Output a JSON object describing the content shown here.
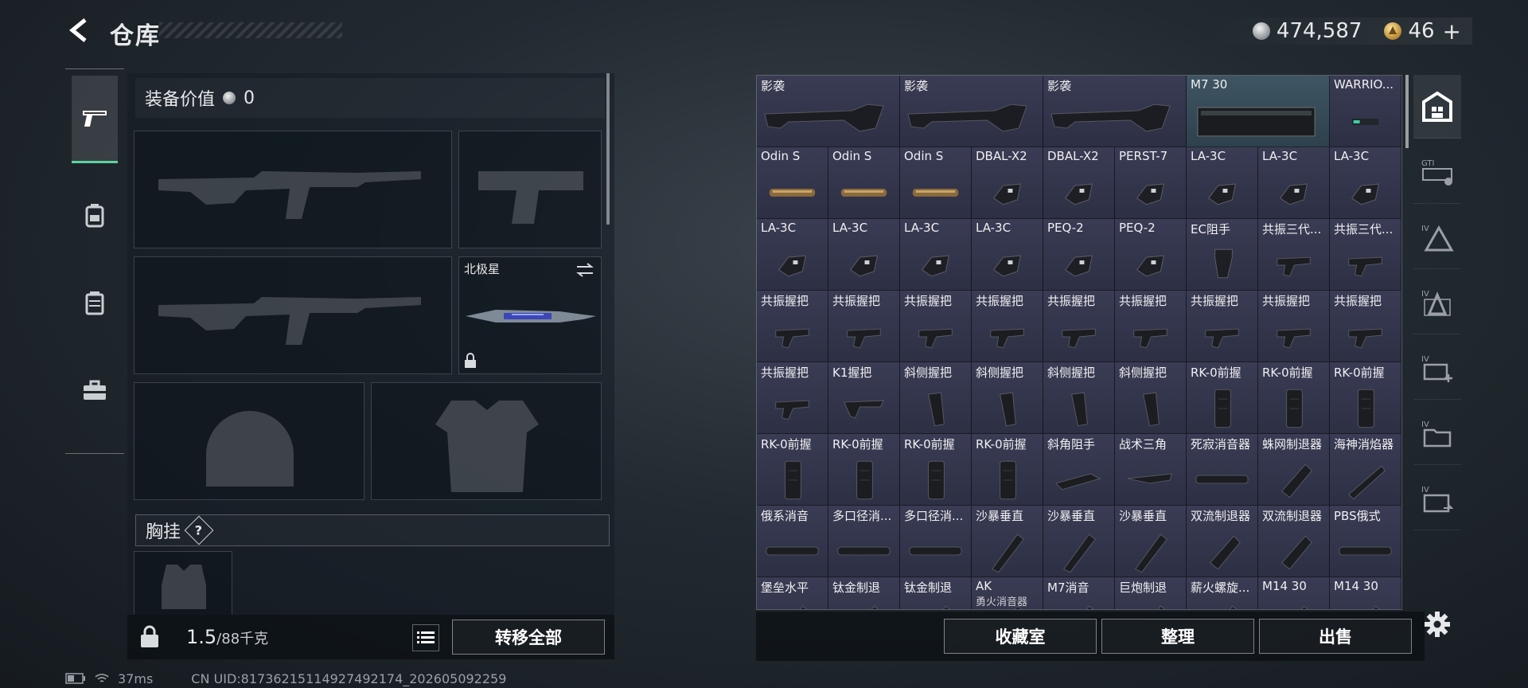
{
  "header": {
    "title": "仓库",
    "currency_amount": "474,587",
    "premium_amount": "46"
  },
  "left_nav": {
    "items": [
      {
        "icon": "pistol-icon",
        "active": true
      },
      {
        "icon": "backpack-icon",
        "active": false
      },
      {
        "icon": "vest-icon",
        "active": false
      },
      {
        "icon": "toolbox-icon",
        "active": false
      }
    ]
  },
  "loadout": {
    "value_label": "装备价值",
    "value_amount": "0",
    "melee_label": "北极星",
    "chest_label": "胸挂",
    "help_label": "?"
  },
  "bottom_left": {
    "weight_current": "1.5",
    "weight_max": "/88千克",
    "transfer_all": "转移全部"
  },
  "status": {
    "ping": "37ms",
    "uid": "CN UID:81736215114927492174_202605092259"
  },
  "grid": {
    "items": [
      {
        "name": "影袭",
        "wide": true,
        "art": "stock"
      },
      {
        "name": "影袭",
        "wide": true,
        "art": "stock"
      },
      {
        "name": "影袭",
        "wide": true,
        "art": "stock"
      },
      {
        "name": "M7 30",
        "wide": true,
        "art": "mag",
        "highlight": true
      },
      {
        "name": "WARRIO...",
        "art": "laser"
      },
      {
        "name": "Odin S",
        "art": "scope-gold"
      },
      {
        "name": "Odin S",
        "art": "scope-gold"
      },
      {
        "name": "Odin S",
        "art": "scope-gold"
      },
      {
        "name": "DBAL-X2",
        "art": "laser-box"
      },
      {
        "name": "DBAL-X2",
        "art": "laser-box"
      },
      {
        "name": "PERST-7",
        "art": "laser-box"
      },
      {
        "name": "LA-3C",
        "art": "laser-box"
      },
      {
        "name": "LA-3C",
        "art": "laser-box"
      },
      {
        "name": "LA-3C",
        "art": "laser-box"
      },
      {
        "name": "LA-3C",
        "art": "laser-box"
      },
      {
        "name": "LA-3C",
        "art": "laser-box"
      },
      {
        "name": "LA-3C",
        "art": "laser-box"
      },
      {
        "name": "LA-3C",
        "art": "laser-box"
      },
      {
        "name": "PEQ-2",
        "art": "laser-box"
      },
      {
        "name": "PEQ-2",
        "art": "laser-box"
      },
      {
        "name": "EC阻手",
        "art": "handstop"
      },
      {
        "name": "共振三代...",
        "art": "grip-angled"
      },
      {
        "name": "共振三代...",
        "art": "grip-angled"
      },
      {
        "name": "共振握把",
        "art": "grip-angled"
      },
      {
        "name": "共振握把",
        "art": "grip-angled"
      },
      {
        "name": "共振握把",
        "art": "grip-angled"
      },
      {
        "name": "共振握把",
        "art": "grip-angled"
      },
      {
        "name": "共振握把",
        "art": "grip-angled"
      },
      {
        "name": "共振握把",
        "art": "grip-angled"
      },
      {
        "name": "共振握把",
        "art": "grip-angled"
      },
      {
        "name": "共振握把",
        "art": "grip-angled"
      },
      {
        "name": "共振握把",
        "art": "grip-angled"
      },
      {
        "name": "共振握把",
        "art": "grip-angled"
      },
      {
        "name": "K1握把",
        "art": "grip-k1"
      },
      {
        "name": "斜侧握把",
        "art": "grip-vert"
      },
      {
        "name": "斜侧握把",
        "art": "grip-vert"
      },
      {
        "name": "斜侧握把",
        "art": "grip-vert"
      },
      {
        "name": "斜侧握把",
        "art": "grip-vert"
      },
      {
        "name": "RK-0前握",
        "art": "grip-tall"
      },
      {
        "name": "RK-0前握",
        "art": "grip-tall"
      },
      {
        "name": "RK-0前握",
        "art": "grip-tall"
      },
      {
        "name": "RK-0前握",
        "art": "grip-tall"
      },
      {
        "name": "RK-0前握",
        "art": "grip-tall"
      },
      {
        "name": "RK-0前握",
        "art": "grip-tall"
      },
      {
        "name": "RK-0前握",
        "art": "grip-tall"
      },
      {
        "name": "斜角阻手",
        "art": "handstop-angle"
      },
      {
        "name": "战术三角",
        "art": "triangle"
      },
      {
        "name": "死寂消音器",
        "art": "suppressor"
      },
      {
        "name": "蛛网制退器",
        "art": "brake"
      },
      {
        "name": "海神消焰器",
        "art": "flash"
      },
      {
        "name": "俄系消音",
        "art": "suppressor"
      },
      {
        "name": "多口径消...",
        "art": "suppressor"
      },
      {
        "name": "多口径消...",
        "art": "suppressor"
      },
      {
        "name": "沙暴垂直",
        "art": "diag"
      },
      {
        "name": "沙暴垂直",
        "art": "diag"
      },
      {
        "name": "沙暴垂直",
        "art": "diag"
      },
      {
        "name": "双流制退器",
        "art": "brake"
      },
      {
        "name": "双流制退器",
        "art": "brake"
      },
      {
        "name": "PBS俄式",
        "art": "suppressor"
      },
      {
        "name": "堡垒水平",
        "art": "diag"
      },
      {
        "name": "钛金制退",
        "art": "diag"
      },
      {
        "name": "钛金制退",
        "art": "diag"
      },
      {
        "name": "AK",
        "sub": "勇火消音器",
        "art": "diag"
      },
      {
        "name": "M7消音",
        "art": "diag"
      },
      {
        "name": "巨炮制退",
        "art": "diag"
      },
      {
        "name": "薪火螺旋...",
        "art": "diag"
      },
      {
        "name": "M14 30",
        "art": "diag"
      },
      {
        "name": "M14 30",
        "art": "diag"
      }
    ]
  },
  "bottom_right": {
    "collection": "收藏室",
    "sort": "整理",
    "sell": "出售"
  },
  "right_rail": {
    "items": [
      {
        "icon": "all-items-icon",
        "active": true
      },
      {
        "icon": "weapon-mod-icon"
      },
      {
        "icon": "tier4-ammo-icon"
      },
      {
        "icon": "tier4-armor-icon"
      },
      {
        "icon": "tier4-medical-icon"
      },
      {
        "icon": "tier4-folder-icon"
      },
      {
        "icon": "tier4-transfer-icon"
      }
    ]
  }
}
